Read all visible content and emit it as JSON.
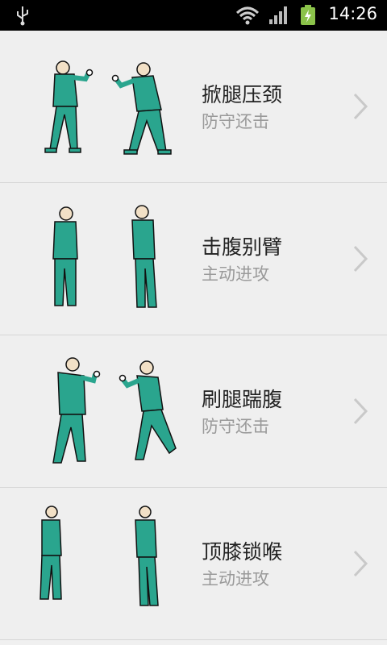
{
  "status_bar": {
    "time": "14:26",
    "icons": [
      "usb-icon",
      "wifi-icon",
      "signal-icon",
      "battery-charging-icon"
    ]
  },
  "colors": {
    "uniform": "#2aa58e",
    "background": "#efefef",
    "title": "#222222",
    "subtitle": "#9a9a9a"
  },
  "items": [
    {
      "title": "掀腿压颈",
      "subtitle": "防守还击"
    },
    {
      "title": "击腹别臂",
      "subtitle": "主动进攻"
    },
    {
      "title": "刷腿踹腹",
      "subtitle": "防守还击"
    },
    {
      "title": "顶膝锁喉",
      "subtitle": "主动进攻"
    }
  ]
}
